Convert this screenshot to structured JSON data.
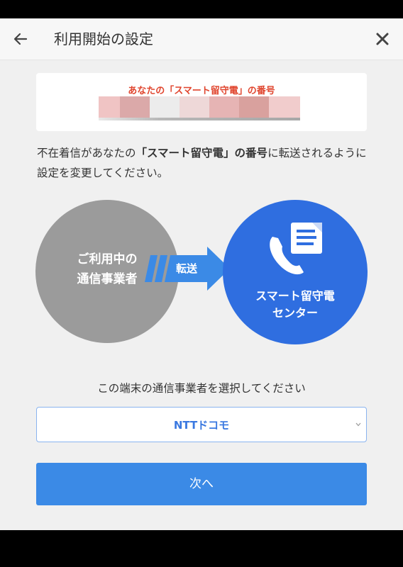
{
  "appbar": {
    "title": "利用開始の設定",
    "back_icon": "arrow-left-icon",
    "close_icon": "close-icon"
  },
  "number_card": {
    "label": "あなたの「スマート留守電」の番号"
  },
  "description": {
    "part1": "不在着信があなたの",
    "emphasis": "「スマート留守電」の番号",
    "part2": "に転送されるように設定を変更してください。"
  },
  "diagram": {
    "carrier_line1": "ご利用中の",
    "carrier_line2": "通信事業者",
    "transfer_label": "転送",
    "center_line1": "スマート留守電",
    "center_line2": "センター",
    "center_icon": "phone-voicemail-icon"
  },
  "carrier_select": {
    "prompt": "この端末の通信事業者を選択してください",
    "selected": "NTTドコモ"
  },
  "next_button": {
    "label": "次へ"
  },
  "colors": {
    "accent_blue": "#3b8ae6",
    "center_blue": "#2f6ee0",
    "label_red": "#e0452e",
    "carrier_gray": "#9b9b9b"
  }
}
